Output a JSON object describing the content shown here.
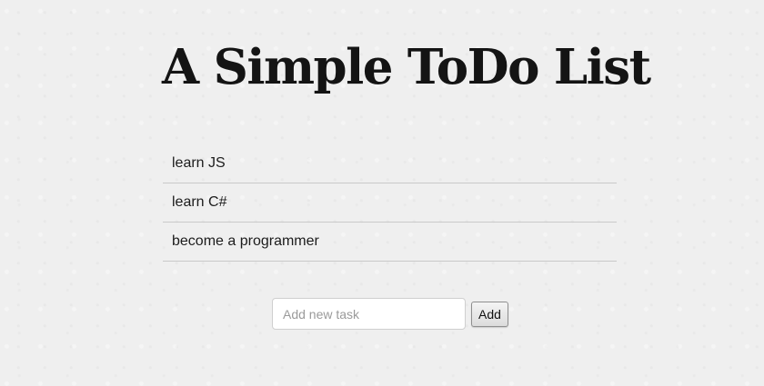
{
  "header": {
    "title": "A Simple ToDo List"
  },
  "tasks": [
    {
      "label": "learn JS"
    },
    {
      "label": "learn C#"
    },
    {
      "label": "become a programmer"
    }
  ],
  "add_form": {
    "placeholder": "Add new task",
    "value": "",
    "button_label": "Add"
  }
}
